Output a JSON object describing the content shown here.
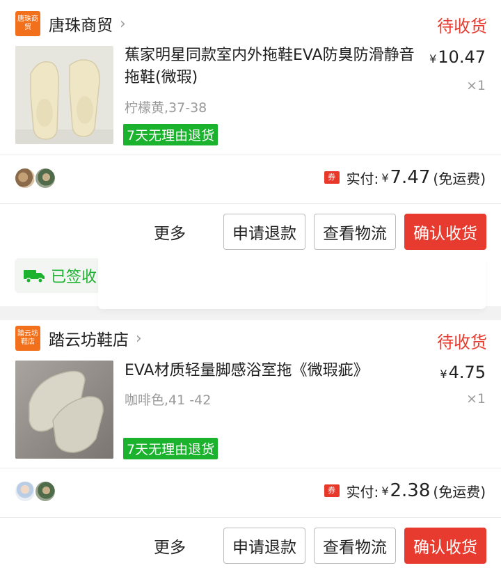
{
  "orders": [
    {
      "shop": {
        "logo_text": "唐珠商贸",
        "name": "唐珠商贸"
      },
      "status": "待收货",
      "product": {
        "title": "蕉家明星同款室内外拖鞋EVA防臭防滑静音拖鞋(微瑕)",
        "sku": "柠檬黄,37-38",
        "badge": "7天无理由退货",
        "currency": "¥",
        "price": "10.47",
        "qty": "×1"
      },
      "paid": {
        "coupon": "券",
        "label": "实付:",
        "currency": "¥",
        "amount": "7.47",
        "note": "(免运费)"
      },
      "actions": {
        "more": "更多",
        "refund": "申请退款",
        "logistics": "查看物流",
        "confirm": "确认收货"
      },
      "logistics_status": "已签收"
    },
    {
      "shop": {
        "logo_text": "踏云坊鞋店",
        "name": "踏云坊鞋店"
      },
      "status": "待收货",
      "product": {
        "title": "EVA材质轻量脚感浴室拖《微瑕疵》",
        "sku": "咖啡色,41 -42",
        "badge": "7天无理由退货",
        "currency": "¥",
        "price": "4.75",
        "qty": "×1"
      },
      "paid": {
        "coupon": "券",
        "label": "实付:",
        "currency": "¥",
        "amount": "2.38",
        "note": "(免运费)"
      },
      "actions": {
        "more": "更多",
        "refund": "申请退款",
        "logistics": "查看物流",
        "confirm": "确认收货"
      }
    }
  ],
  "icons": [
    "chevron-right-icon",
    "coupon-icon",
    "truck-icon"
  ],
  "colors": {
    "accent": "#e63b2e",
    "badge_green": "#1bb32e",
    "shop_logo": "#f2701b"
  }
}
